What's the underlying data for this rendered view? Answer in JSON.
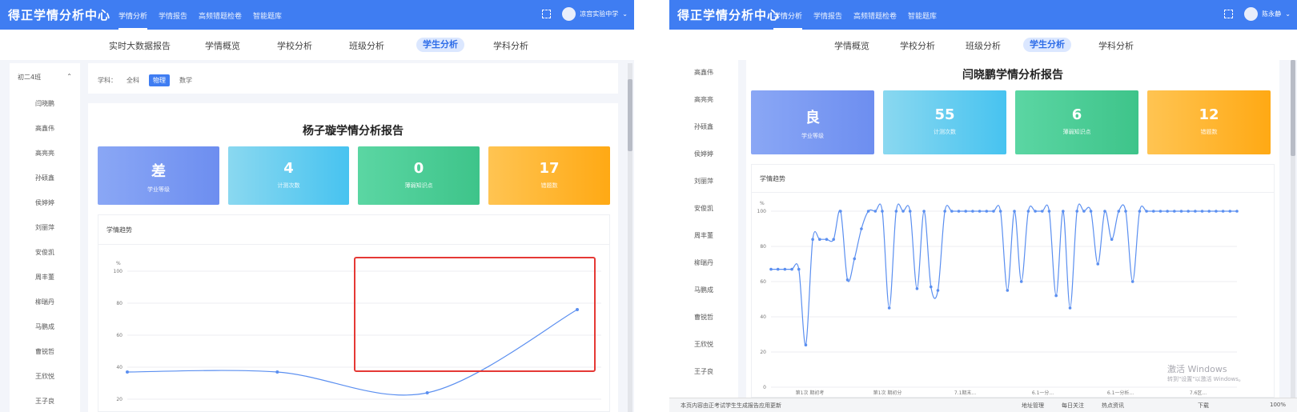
{
  "app": {
    "brand": "得正学情分析中心"
  },
  "left": {
    "nav": [
      "学情分析",
      "学情报告",
      "高频错题检卷",
      "智能题库"
    ],
    "user": "凉宫实验中学",
    "tabs": [
      "实时大数据报告",
      "学情概览",
      "学校分析",
      "班级分析",
      "学生分析",
      "学科分析"
    ],
    "sidebar": {
      "group": "初二4班",
      "students": [
        "闫晓鹏",
        "高鑫伟",
        "高亮亮",
        "孙硕鑫",
        "侯婷婷",
        "刘丽萍",
        "安俊凯",
        "周丰董",
        "柳瑞丹",
        "马鹏成",
        "曹锐哲",
        "王欣悦",
        "王子良"
      ]
    },
    "filter": {
      "label": "学科：",
      "options": [
        "全科",
        "物理",
        "数学"
      ],
      "active": "物理"
    },
    "report_title": "杨子璇学情分析报告",
    "stats": [
      {
        "value": "差",
        "label": "学业等级"
      },
      {
        "value": "4",
        "label": "计测次数"
      },
      {
        "value": "0",
        "label": "薄弱知识点"
      },
      {
        "value": "17",
        "label": "错题数"
      }
    ],
    "trend_title": "学情趋势"
  },
  "right": {
    "nav": [
      "学情分析",
      "学情报告",
      "高频错题检卷",
      "智能题库"
    ],
    "user": "陈永静",
    "tabs": [
      "学情概览",
      "学校分析",
      "班级分析",
      "学生分析",
      "学科分析"
    ],
    "sidebar": {
      "students": [
        "高鑫伟",
        "高亮亮",
        "孙硕鑫",
        "侯婷婷",
        "刘丽萍",
        "安俊凯",
        "周丰董",
        "柳瑞丹",
        "马鹏成",
        "曹锐哲",
        "王欣悦",
        "王子良"
      ]
    },
    "report_title": "闫晓鹏学情分析报告",
    "stats": [
      {
        "value": "良",
        "label": "学业等级"
      },
      {
        "value": "55",
        "label": "计测次数"
      },
      {
        "value": "6",
        "label": "薄弱知识点"
      },
      {
        "value": "12",
        "label": "错题数"
      }
    ],
    "trend_title": "学情趋势",
    "taskbar": [
      "本页内容由正考试学生生成报告应用更新",
      "地址管理",
      "每日关注",
      "热点资讯",
      "下载",
      "100%"
    ],
    "watermark": {
      "line1": "激活 Windows",
      "line2": "转到\"设置\"以激活 Windows。"
    }
  },
  "colors": {
    "brand": "#3f7df2",
    "line": "#5b8ff0",
    "highlight": "#e53935"
  },
  "chart_data": [
    {
      "type": "line",
      "ylabel": "%",
      "ylim": [
        20,
        100
      ],
      "yticks": [
        20,
        40,
        60,
        80,
        100
      ],
      "x": [
        1,
        2,
        3,
        4
      ],
      "series": [
        {
          "values": [
            37,
            37,
            24,
            76
          ]
        }
      ],
      "annotation": "highlighted rectangle over last segment"
    },
    {
      "type": "line",
      "ylabel": "%",
      "ylim": [
        0,
        100
      ],
      "yticks": [
        0,
        20,
        40,
        60,
        80,
        100
      ],
      "x_tick_labels": [
        "第1次 期初考",
        "第1次 期初分",
        "7.1期末...",
        "6.1一分...",
        "6.1一分析...",
        "7.6区..."
      ],
      "series": [
        {
          "values": [
            67,
            67,
            67,
            67,
            67,
            24,
            84,
            84,
            84,
            84,
            100,
            61,
            73,
            90,
            100,
            100,
            100,
            45,
            100,
            100,
            100,
            56,
            100,
            57,
            55,
            100,
            100,
            100,
            100,
            100,
            100,
            100,
            100,
            100,
            55,
            100,
            60,
            100,
            100,
            100,
            100,
            52,
            100,
            45,
            100,
            100,
            100,
            70,
            100,
            84,
            100,
            100,
            60,
            100,
            100,
            100,
            100,
            100,
            100,
            100,
            100,
            100,
            100,
            100,
            100,
            100,
            100,
            100
          ]
        }
      ]
    }
  ]
}
